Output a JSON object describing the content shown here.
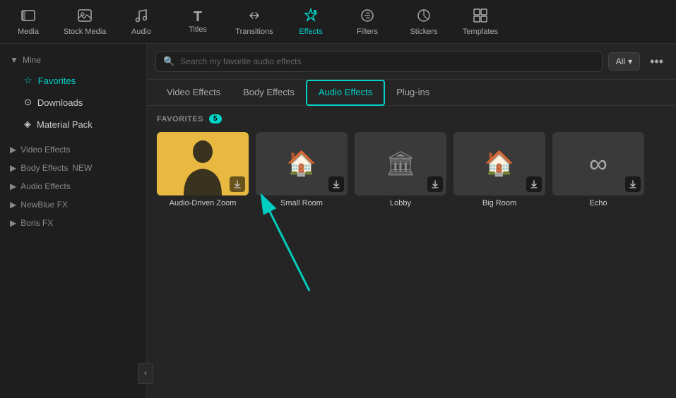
{
  "topNav": {
    "items": [
      {
        "id": "media",
        "label": "Media",
        "icon": "🎬",
        "active": false
      },
      {
        "id": "stock-media",
        "label": "Stock Media",
        "icon": "📷",
        "active": false
      },
      {
        "id": "audio",
        "label": "Audio",
        "icon": "🎵",
        "active": false
      },
      {
        "id": "titles",
        "label": "Titles",
        "icon": "T",
        "active": false
      },
      {
        "id": "transitions",
        "label": "Transitions",
        "icon": "⇄",
        "active": false
      },
      {
        "id": "effects",
        "label": "Effects",
        "icon": "✦",
        "active": true
      },
      {
        "id": "filters",
        "label": "Filters",
        "icon": "◈",
        "active": false
      },
      {
        "id": "stickers",
        "label": "Stickers",
        "icon": "◉",
        "active": false
      },
      {
        "id": "templates",
        "label": "Templates",
        "icon": "▦",
        "active": false
      }
    ]
  },
  "sidebar": {
    "mine_label": "Mine",
    "items": [
      {
        "id": "favorites",
        "label": "Favorites",
        "icon": "★",
        "active": true,
        "badge": null
      },
      {
        "id": "downloads",
        "label": "Downloads",
        "icon": "⊙",
        "active": false,
        "badge": null
      },
      {
        "id": "material-pack",
        "label": "Material Pack",
        "icon": "◈",
        "active": false,
        "badge": null
      }
    ],
    "categories": [
      {
        "id": "video-effects",
        "label": "Video Effects",
        "active": false,
        "badge": null
      },
      {
        "id": "body-effects",
        "label": "Body Effects",
        "active": false,
        "badge": "NEW"
      },
      {
        "id": "audio-effects",
        "label": "Audio Effects",
        "active": false,
        "badge": null
      },
      {
        "id": "newblue-fx",
        "label": "NewBlue FX",
        "active": false,
        "badge": null
      },
      {
        "id": "boris-fx",
        "label": "Boris FX",
        "active": false,
        "badge": null
      }
    ]
  },
  "search": {
    "placeholder": "Search my favorite audio effects",
    "filter_label": "All",
    "more_icon": "•••"
  },
  "tabs": [
    {
      "id": "video-effects",
      "label": "Video Effects",
      "active": false
    },
    {
      "id": "body-effects",
      "label": "Body Effects",
      "active": false
    },
    {
      "id": "audio-effects",
      "label": "Audio Effects",
      "active": true
    },
    {
      "id": "plug-ins",
      "label": "Plug-ins",
      "active": false
    }
  ],
  "favoritesSection": {
    "title": "FAVORITES",
    "count": "5"
  },
  "effectCards": [
    {
      "id": "audio-driven-zoom",
      "label": "Audio-Driven Zoom",
      "thumbType": "person",
      "hasDownload": true
    },
    {
      "id": "small-room",
      "label": "Small Room",
      "thumbType": "house",
      "hasDownload": true
    },
    {
      "id": "lobby",
      "label": "Lobby",
      "thumbType": "columns",
      "hasDownload": true
    },
    {
      "id": "big-room",
      "label": "Big Room",
      "thumbType": "house2",
      "hasDownload": true
    },
    {
      "id": "echo",
      "label": "Echo",
      "thumbType": "infinity",
      "hasDownload": true
    }
  ],
  "collapseBtn": "‹"
}
